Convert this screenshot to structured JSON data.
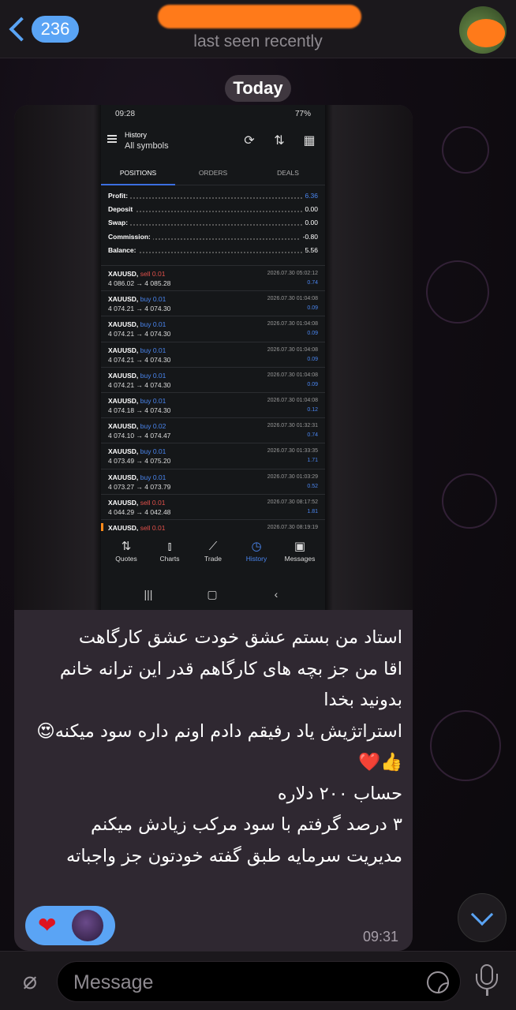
{
  "header": {
    "unread_count": "236",
    "status": "last seen recently"
  },
  "date_pill": "Today",
  "phone": {
    "time": "09:28",
    "battery": "77%",
    "title": "History",
    "subtitle": "All symbols",
    "tabs": [
      "POSITIONS",
      "ORDERS",
      "DEALS"
    ],
    "summary": [
      {
        "label": "Profit:",
        "value": "6.36"
      },
      {
        "label": "Deposit",
        "value": "0.00"
      },
      {
        "label": "Swap:",
        "value": "0.00"
      },
      {
        "label": "Commission:",
        "value": "-0.80"
      },
      {
        "label": "Balance:",
        "value": "5.56"
      }
    ],
    "deals": [
      {
        "symbol": "XAUUSD,",
        "side": "sell 0.01",
        "prices": "4 086.02 → 4 085.28",
        "time": "2026.07.30 05:02:12",
        "profit": "0.74"
      },
      {
        "symbol": "XAUUSD,",
        "side": "buy 0.01",
        "prices": "4 074.21 → 4 074.30",
        "time": "2026.07.30 01:04:08",
        "profit": "0.09"
      },
      {
        "symbol": "XAUUSD,",
        "side": "buy 0.01",
        "prices": "4 074.21 → 4 074.30",
        "time": "2026.07.30 01:04:08",
        "profit": "0.09"
      },
      {
        "symbol": "XAUUSD,",
        "side": "buy 0.01",
        "prices": "4 074.21 → 4 074.30",
        "time": "2026.07.30 01:04:08",
        "profit": "0.09"
      },
      {
        "symbol": "XAUUSD,",
        "side": "buy 0.01",
        "prices": "4 074.21 → 4 074.30",
        "time": "2026.07.30 01:04:08",
        "profit": "0.09"
      },
      {
        "symbol": "XAUUSD,",
        "side": "buy 0.01",
        "prices": "4 074.18 → 4 074.30",
        "time": "2026.07.30 01:04:08",
        "profit": "0.12"
      },
      {
        "symbol": "XAUUSD,",
        "side": "buy 0.02",
        "prices": "4 074.10 → 4 074.47",
        "time": "2026.07.30 01:32:31",
        "profit": "0.74"
      },
      {
        "symbol": "XAUUSD,",
        "side": "buy 0.01",
        "prices": "4 073.49 → 4 075.20",
        "time": "2026.07.30 01:33:35",
        "profit": "1.71"
      },
      {
        "symbol": "XAUUSD,",
        "side": "buy 0.01",
        "prices": "4 073.27 → 4 073.79",
        "time": "2026.07.30 01:03:29",
        "profit": "0.52"
      },
      {
        "symbol": "XAUUSD,",
        "side": "sell 0.01",
        "prices": "4 044.29 → 4 042.48",
        "time": "2026.07.30 08:17:52",
        "profit": "1.81"
      },
      {
        "symbol": "XAUUSD,",
        "side": "sell 0.01",
        "prices": "",
        "time": "2026.07.30 08:19:19",
        "profit": ""
      }
    ],
    "nav": [
      {
        "label": "Quotes",
        "icon": "quotes-icon"
      },
      {
        "label": "Charts",
        "icon": "charts-icon"
      },
      {
        "label": "Trade",
        "icon": "trade-icon"
      },
      {
        "label": "History",
        "icon": "history-icon"
      },
      {
        "label": "Messages",
        "icon": "messages-icon"
      }
    ],
    "colors": {
      "buy": "#4a86f0",
      "sell": "#e0504a",
      "accent": "#3c6fe0"
    }
  },
  "message": {
    "text": "استاد من بستم عشق خودت عشق کارگاهت\nاقا من جز بچه های کارگاهم قدر این ترانه خانم بدونید بخدا\nاستراتژیش یاد رفیقم دادم اونم داره سود میکنه😍👍❤️\nحساب ۲۰۰ دلاره\n۳ درصد گرفتم با سود مرکب زیادش میکنم\nمدیریت سرمایه طبق گفته خودتون جز واجباته",
    "time": "09:31",
    "reaction": "❤"
  },
  "composer": {
    "placeholder": "Message"
  },
  "colors": {
    "accent": "#5aa4f5",
    "bubble": "#2f2831",
    "bar": "#1b181c"
  }
}
